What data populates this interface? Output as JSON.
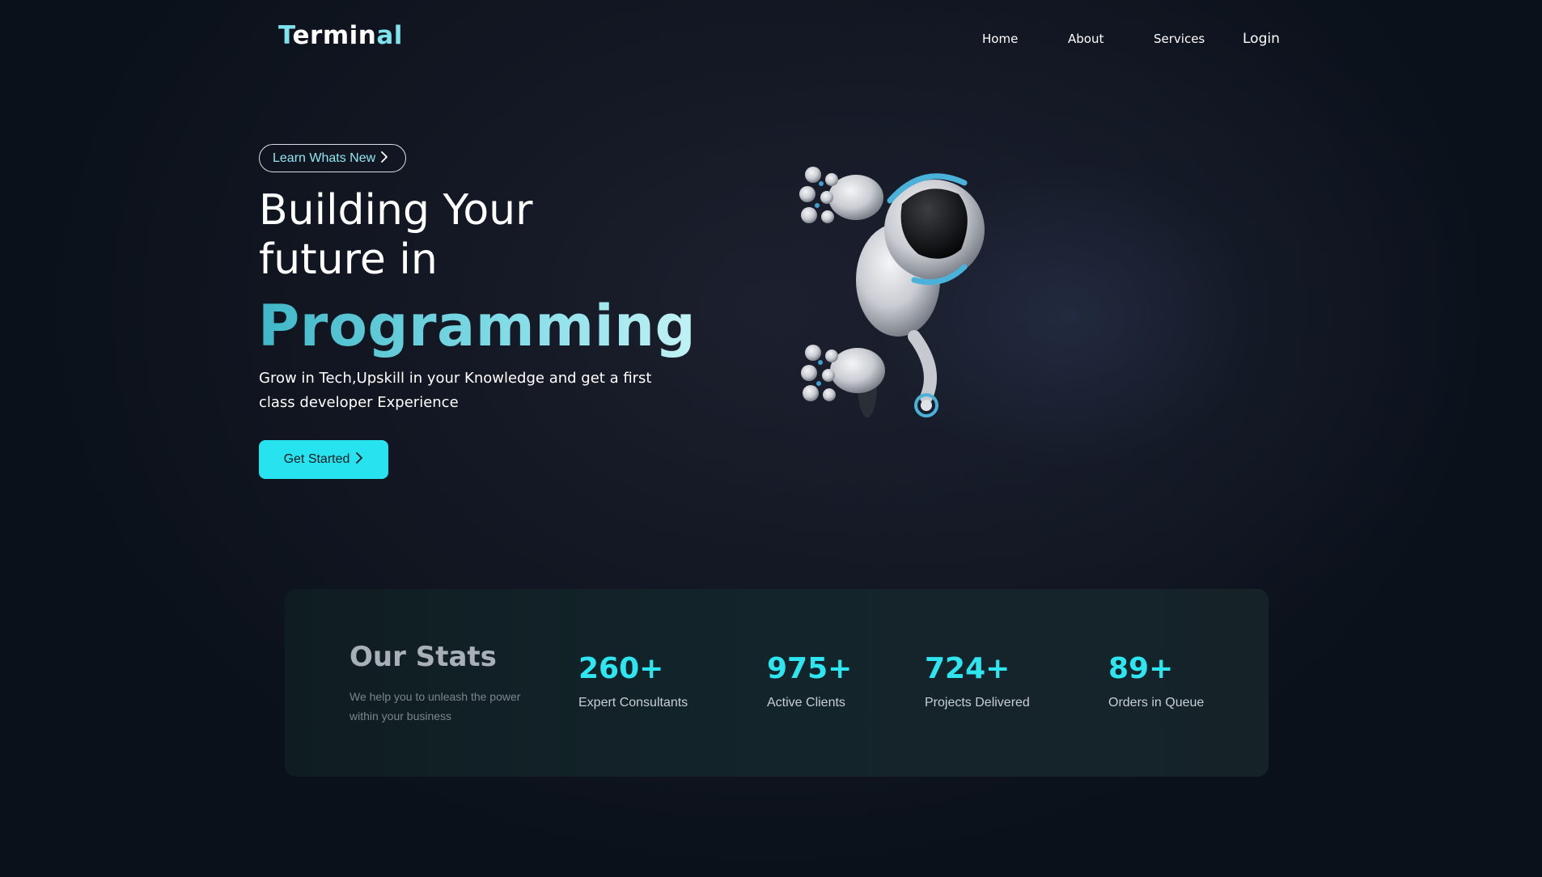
{
  "nav": {
    "logo": {
      "part1": "T",
      "part2": "ermin",
      "part3": "al"
    },
    "links": [
      "Home",
      "About",
      "Services"
    ],
    "login": "Login"
  },
  "hero": {
    "badge": "Learn Whats New",
    "title_line1": "Building Your",
    "title_line2": "future in",
    "title_accent": "Programming",
    "subtitle": "Grow in Tech,Upskill in your Knowledge and get a first class developer Experience",
    "cta": "Get Started",
    "image": "robot-peeking-illustration"
  },
  "stats": {
    "title": "Our Stats",
    "description": "We help you to unleash the power within your business",
    "items": [
      {
        "value": "260+",
        "label": "Expert Consultants"
      },
      {
        "value": "975+",
        "label": "Active Clients"
      },
      {
        "value": "724+",
        "label": "Projects Delivered"
      },
      {
        "value": "89+",
        "label": "Orders in Queue"
      }
    ]
  },
  "colors": {
    "accent": "#27e3ef",
    "background": "#0b111b",
    "stats_panel": "#13252b",
    "stat_number": "#2ee6f0"
  },
  "icons": {
    "badge_chevron": "chevron-right-icon",
    "cta_chevron": "chevron-right-icon"
  }
}
